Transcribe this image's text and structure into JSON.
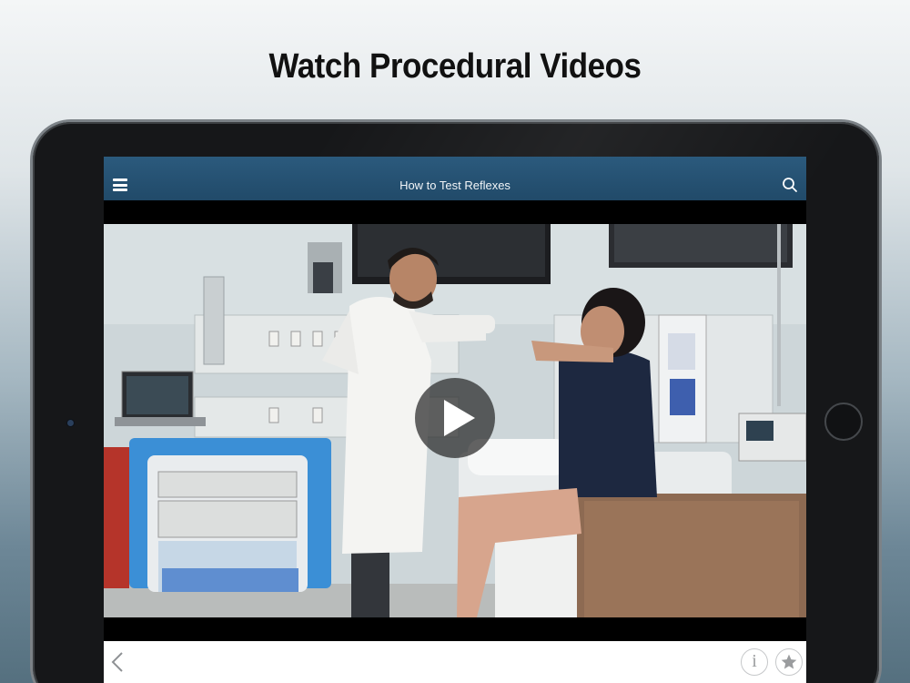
{
  "headline": "Watch Procedural Videos",
  "app": {
    "title": "How to Test Reflexes",
    "accent_color": "#234d6c",
    "icons": {
      "menu": "hamburger-menu-icon",
      "search": "search-icon",
      "play": "play-icon",
      "back": "chevron-left-icon",
      "info": "info-icon",
      "favorite": "star-icon"
    },
    "info_glyph": "i"
  },
  "video": {
    "description_scene": "hospital-exam-room",
    "state": "paused"
  }
}
